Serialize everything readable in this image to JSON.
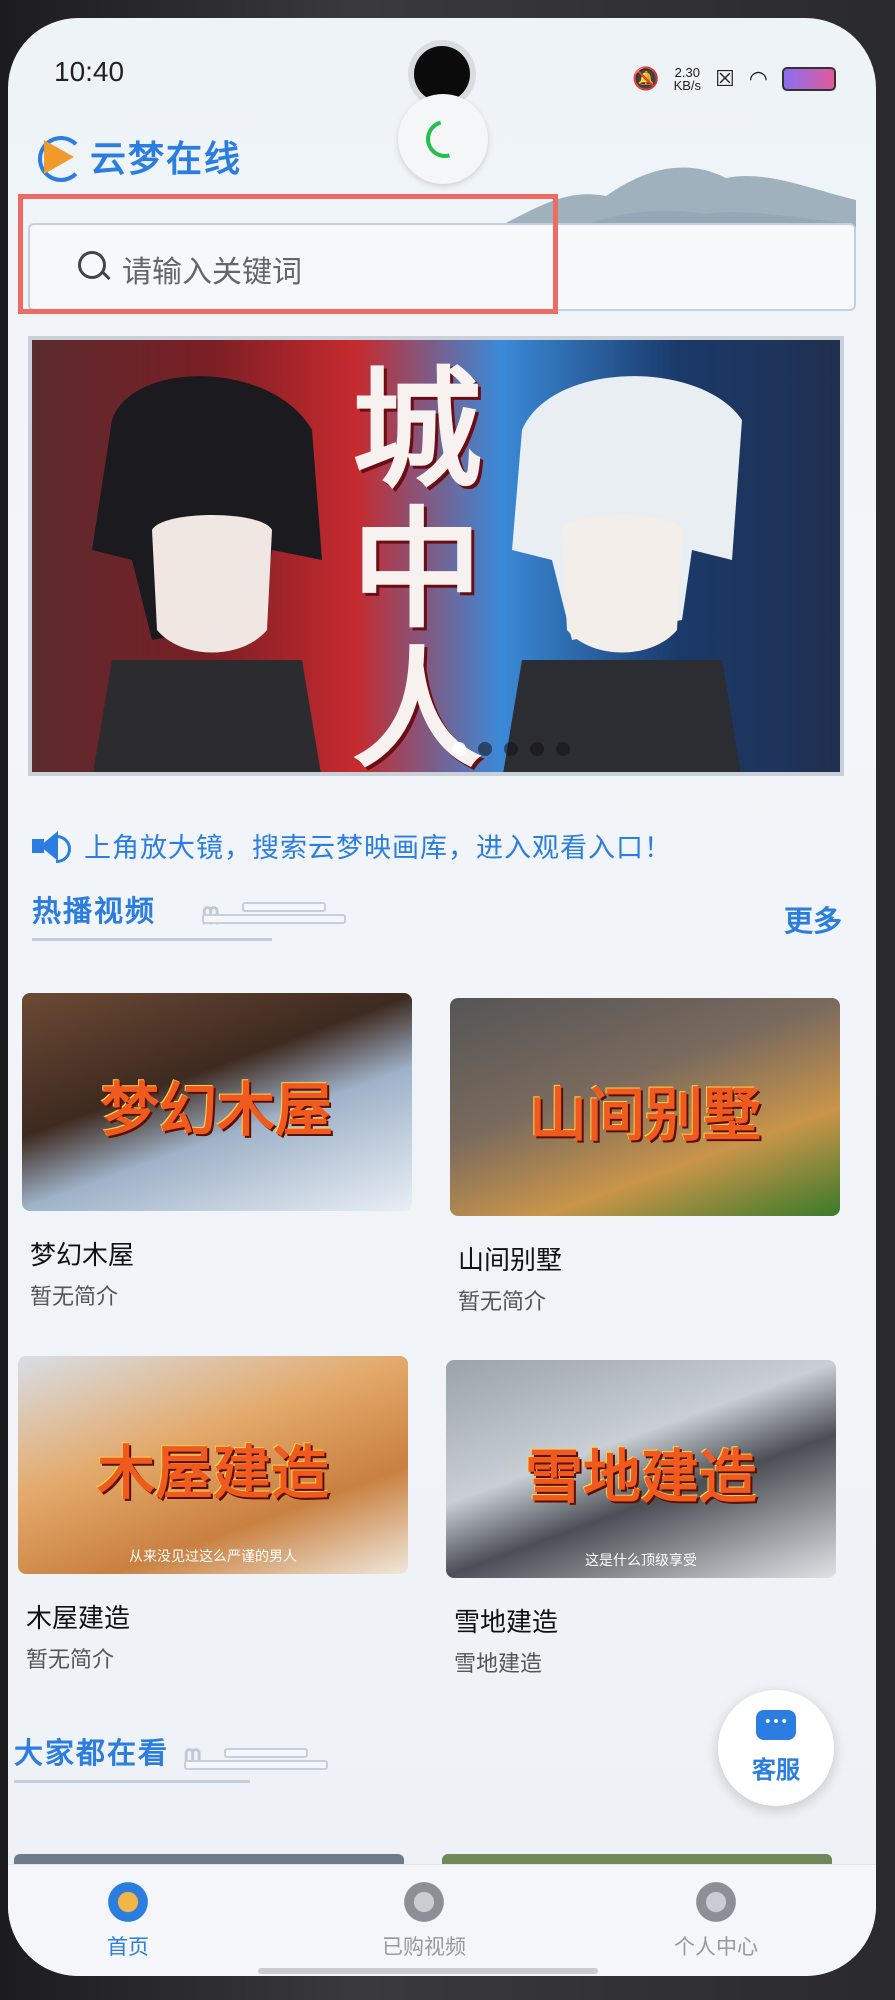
{
  "status_bar": {
    "time": "10:40",
    "net_speed_value": "2.30",
    "net_speed_unit": "KB/s"
  },
  "header": {
    "app_title": "云梦在线"
  },
  "search": {
    "placeholder": "请输入关键词"
  },
  "banner": {
    "title_chars": [
      "城",
      "中",
      "人"
    ],
    "slide_count": 5,
    "active_slide": 0
  },
  "notice": {
    "text": "上角放大镜，搜索云梦映画库，进入观看入口！"
  },
  "hot_videos": {
    "title": "热播视频",
    "more_label": "更多",
    "items": [
      {
        "title": "梦幻木屋",
        "thumb_text": "梦幻木屋",
        "desc": "暂无简介",
        "thumb_sub": ""
      },
      {
        "title": "山间别墅",
        "thumb_text": "山间别墅",
        "desc": "暂无简介",
        "thumb_sub": ""
      },
      {
        "title": "木屋建造",
        "thumb_text": "木屋建造",
        "desc": "暂无简介",
        "thumb_sub": "从来没见过这么严谨的男人"
      },
      {
        "title": "雪地建造",
        "thumb_text": "雪地建造",
        "desc": "雪地建造",
        "thumb_sub": "这是什么顶级享受"
      }
    ]
  },
  "everyone_watching": {
    "title": "大家都在看"
  },
  "service_button": {
    "label": "客服"
  },
  "bottom_nav": {
    "items": [
      {
        "label": "首页",
        "active": true
      },
      {
        "label": "已购视频",
        "active": false
      },
      {
        "label": "个人中心",
        "active": false
      }
    ]
  },
  "colors": {
    "accent": "#2b7ee0",
    "highlight": "#ec6b63"
  }
}
